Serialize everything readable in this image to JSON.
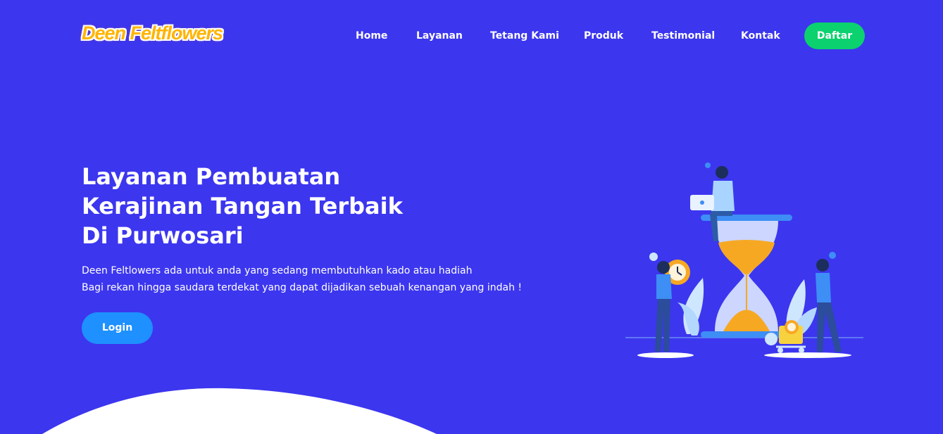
{
  "header": {
    "logo_text": "Deen Feltflowers",
    "nav_items": [
      {
        "label": "Home"
      },
      {
        "label": "Layanan"
      },
      {
        "label": "Tetang Kami"
      },
      {
        "label": "Produk"
      },
      {
        "label": "Testimonial"
      },
      {
        "label": "Kontak"
      }
    ],
    "cta_label": "Daftar"
  },
  "hero": {
    "title_lines": [
      "Layanan Pembuatan",
      "Kerajinan Tangan Terbaik",
      "Di Purwosari"
    ],
    "description_lines": [
      "Deen Feltlowers ada untuk anda yang sedang membutuhkan kado atau hadiah",
      "Bagi rekan hingga saudara terdekat yang dapat dijadikan sebuah kenangan yang indah !"
    ],
    "login_label": "Login"
  },
  "colors": {
    "background": "#3c36ef",
    "daftar_button": "#0bd16e",
    "login_button": "#1e90ff",
    "logo": "#ffb400"
  },
  "illustration": {
    "icons": [
      "hourglass-icon",
      "person-laptop-icon",
      "clock-gear-icon",
      "cart-icon",
      "plant-icon"
    ]
  }
}
